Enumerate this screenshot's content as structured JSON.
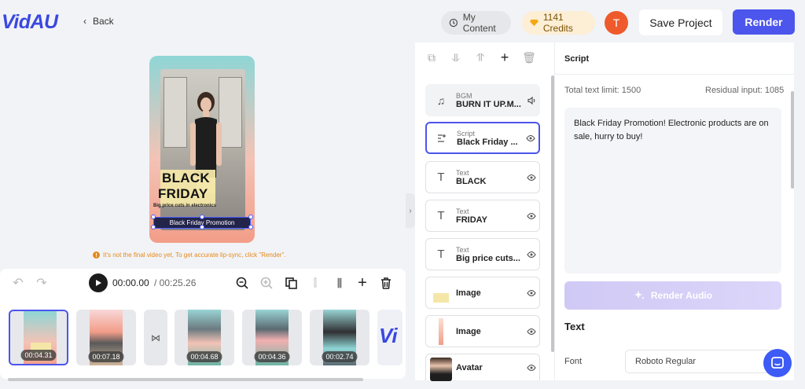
{
  "app": {
    "logo": "VidAU"
  },
  "header": {
    "back_label": "Back",
    "my_content_label": "My Content",
    "credits_label": "1141 Credits",
    "user_initial": "T",
    "save_project_label": "Save Project",
    "render_label": "Render"
  },
  "preview": {
    "overlay_line1": "BLACK",
    "overlay_line2": "FRIDAY",
    "overlay_line3": "Big price cuts in electronics",
    "caption": "Black Friday Promotion",
    "notice": "It's not the final video yet, To get accurate lip-sync, click \"Render\"."
  },
  "timeline": {
    "current_time": "00:00.00",
    "total_time": "/ 00:25.26",
    "clips": [
      {
        "duration": "00:04.31"
      },
      {
        "duration": "00:07.18"
      },
      {
        "duration": "00:04.68"
      },
      {
        "duration": "00:04.36"
      },
      {
        "duration": "00:02.74"
      }
    ],
    "last_clip_logo": "Vi"
  },
  "layers": [
    {
      "type": "BGM",
      "name": "BURN IT UP.M...",
      "icon": "music-icon"
    },
    {
      "type": "Script",
      "name": "Black Friday ...",
      "icon": "script-icon"
    },
    {
      "type": "Text",
      "name": "BLACK",
      "icon": "text-icon"
    },
    {
      "type": "Text",
      "name": "FRIDAY",
      "icon": "text-icon"
    },
    {
      "type": "Text",
      "name": "Big price cuts...",
      "icon": "text-icon"
    },
    {
      "type": "",
      "name": "Image",
      "icon": "image-thumb"
    },
    {
      "type": "",
      "name": "Image",
      "icon": "image-thumb"
    },
    {
      "type": "",
      "name": "Avatar",
      "icon": "avatar-thumb"
    }
  ],
  "script_panel": {
    "title": "Script",
    "total_limit": "Total text limit: 1500",
    "residual": "Residual input: 1085",
    "script_text": "Black Friday Promotion! Electronic products are on sale, hurry to buy!",
    "render_audio_label": "Render Audio",
    "text_section_title": "Text",
    "font_label": "Font",
    "font_value": "Roboto Regular"
  },
  "colors": {
    "accent": "#4c55ec",
    "warning": "#e58a1c"
  }
}
